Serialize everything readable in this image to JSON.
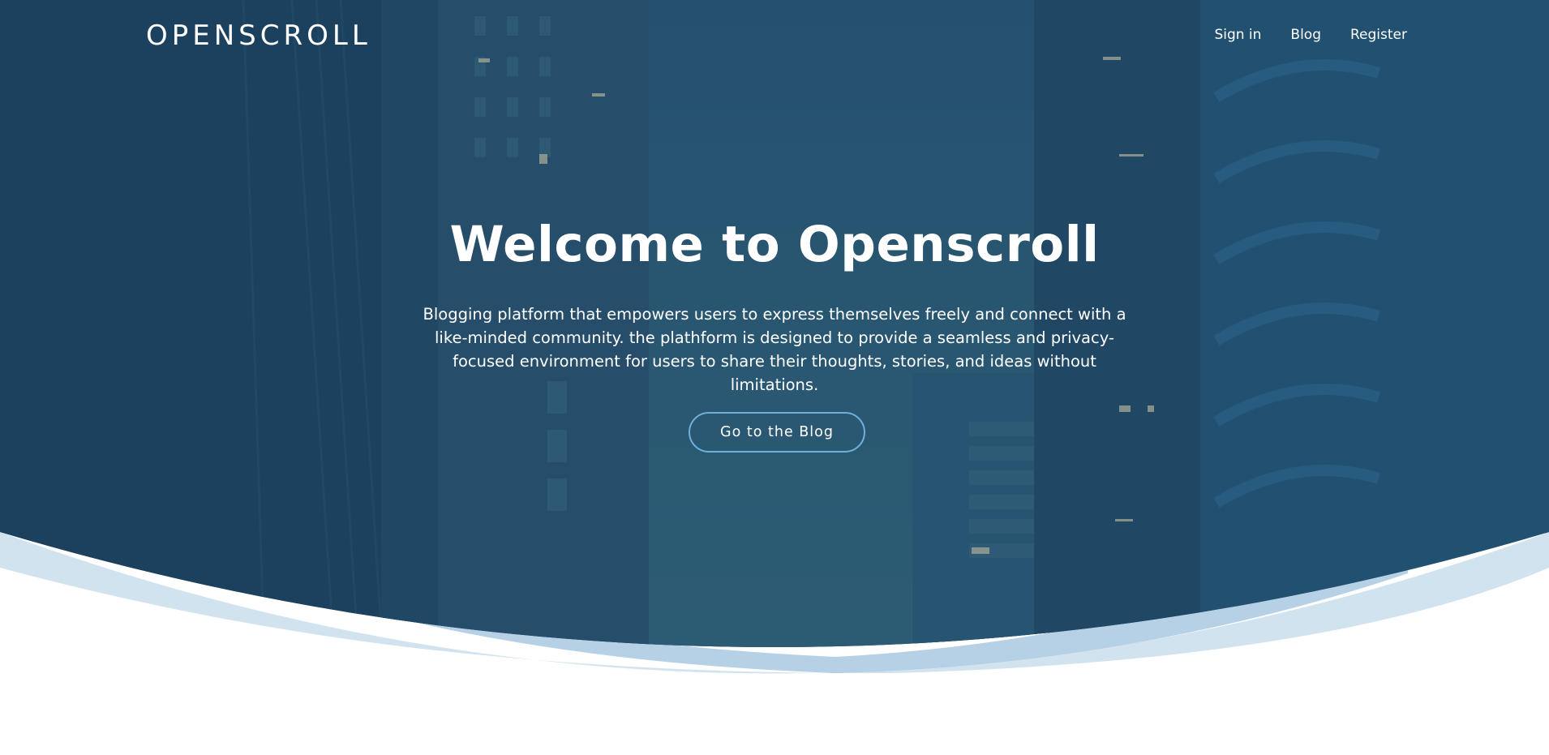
{
  "brand": {
    "name": "OPENSCROLL"
  },
  "nav": {
    "items": [
      {
        "label": "Sign in"
      },
      {
        "label": "Blog"
      },
      {
        "label": "Register"
      }
    ]
  },
  "hero": {
    "title": "Welcome to Openscroll",
    "description": "Blogging platform that empowers users to express themselves freely and connect with a like-minded community. the plathform is designed to provide a seamless and privacy-focused environment for users to share their thoughts, stories, and ideas without limitations.",
    "cta_label": "Go to the Blog"
  },
  "colors": {
    "hero_overlay": "#1f4766",
    "wave_light": "#d1e3ee",
    "wave_mid": "#a9c9e0",
    "button_border": "#6fb0dc",
    "text": "#ffffff"
  }
}
